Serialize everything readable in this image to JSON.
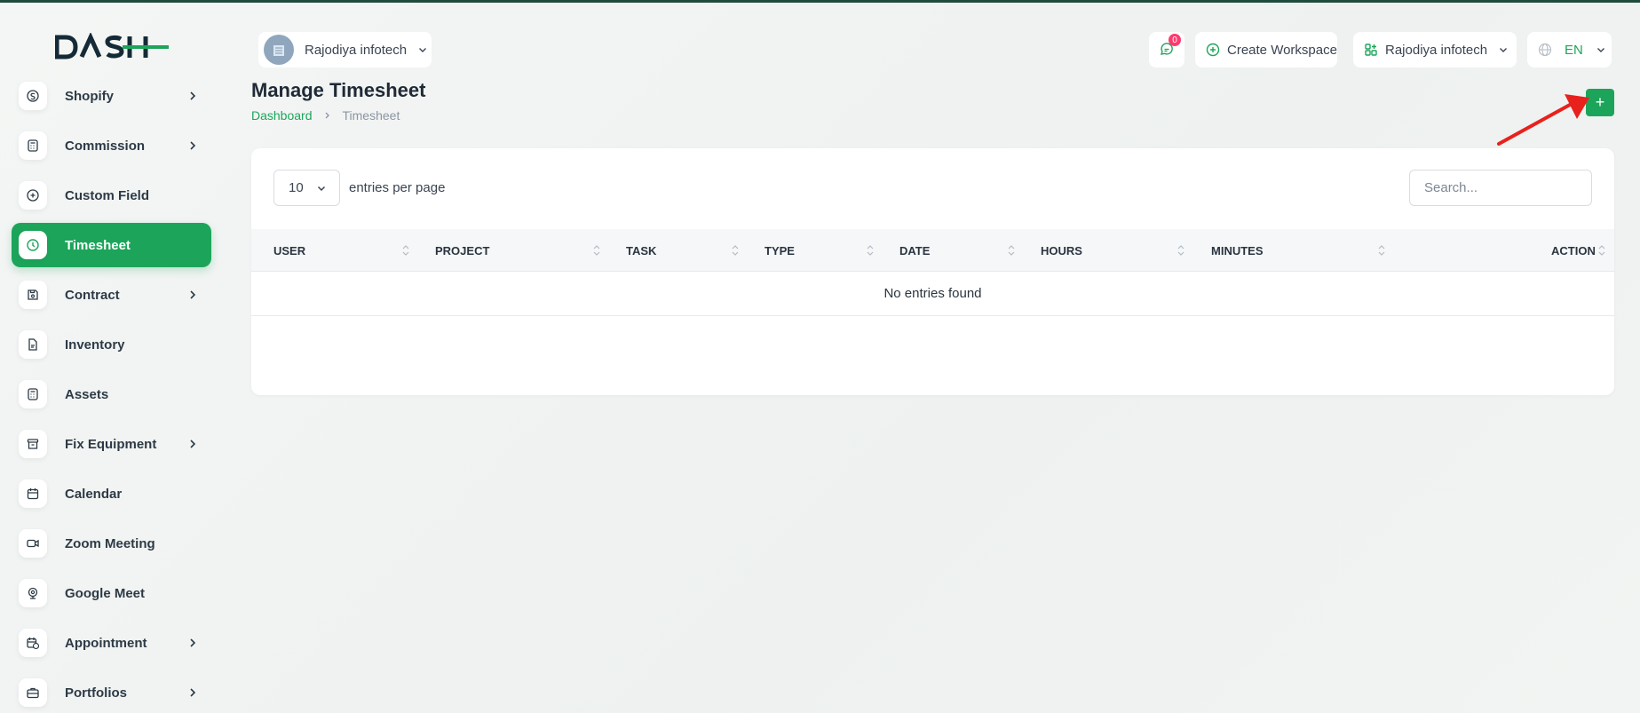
{
  "brand": {
    "logo_text": "DASH",
    "accent": "#1ca55a"
  },
  "sidebar": {
    "items": [
      {
        "label": "Shopify",
        "icon": "shopify-icon",
        "has_submenu": true
      },
      {
        "label": "Commission",
        "icon": "calculator-icon",
        "has_submenu": true
      },
      {
        "label": "Custom Field",
        "icon": "plus-circle-icon",
        "has_submenu": false
      },
      {
        "label": "Timesheet",
        "icon": "clock-icon",
        "has_submenu": false,
        "active": true
      },
      {
        "label": "Contract",
        "icon": "device-floppy-icon",
        "has_submenu": true
      },
      {
        "label": "Inventory",
        "icon": "file-icon",
        "has_submenu": false
      },
      {
        "label": "Assets",
        "icon": "calculator-icon",
        "has_submenu": false
      },
      {
        "label": "Fix Equipment",
        "icon": "archive-icon",
        "has_submenu": true
      },
      {
        "label": "Calendar",
        "icon": "calendar-icon",
        "has_submenu": false
      },
      {
        "label": "Zoom Meeting",
        "icon": "video-icon",
        "has_submenu": false
      },
      {
        "label": "Google Meet",
        "icon": "webcam-icon",
        "has_submenu": false
      },
      {
        "label": "Appointment",
        "icon": "calendar-time-icon",
        "has_submenu": true
      },
      {
        "label": "Portfolios",
        "icon": "briefcase-icon",
        "has_submenu": true
      }
    ]
  },
  "header": {
    "workspace_name": "Rajodiya infotech",
    "notification_count": "0",
    "create_workspace_label": "Create Workspace",
    "org_name": "Rajodiya infotech",
    "language": "EN"
  },
  "page": {
    "title": "Manage Timesheet",
    "breadcrumb_home": "Dashboard",
    "breadcrumb_current": "Timesheet",
    "add_button_label": "+"
  },
  "table": {
    "per_page_value": "10",
    "per_page_label": "entries per page",
    "search_placeholder": "Search...",
    "columns": [
      "USER",
      "PROJECT",
      "TASK",
      "TYPE",
      "DATE",
      "HOURS",
      "MINUTES",
      "ACTION"
    ],
    "empty_message": "No entries found"
  }
}
